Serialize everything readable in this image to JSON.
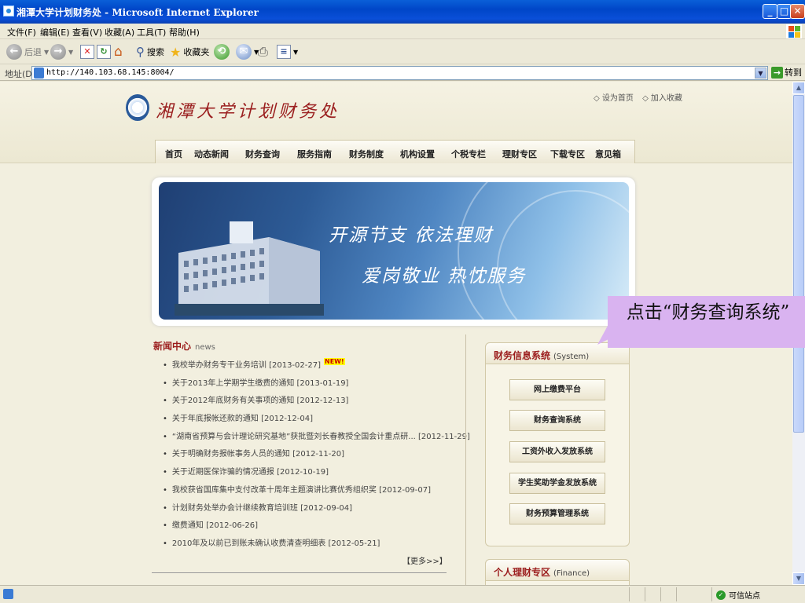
{
  "window": {
    "title": "湘潭大学计划财务处 - Microsoft Internet Explorer",
    "min_label": "_",
    "max_label": "□",
    "close_label": "✕"
  },
  "menu": [
    "文件(F)",
    "编辑(E)",
    "查看(V)",
    "收藏(A)",
    "工具(T)",
    "帮助(H)"
  ],
  "toolbar": {
    "back_label": "后退",
    "search_label": "搜索",
    "favorites_label": "收藏夹"
  },
  "address": {
    "label": "地址(D)",
    "url": "http://140.103.68.145:8004/",
    "go_label": "转到"
  },
  "site": {
    "title": "湘潭大学计划财务处",
    "toplinks": [
      "◇ 设为首页",
      "◇ 加入收藏"
    ],
    "nav": [
      "首页",
      "动态新闻",
      "财务查询",
      "服务指南",
      "财务制度",
      "机构设置",
      "个税专栏",
      "理财专区",
      "下载专区",
      "意见箱"
    ],
    "banner": {
      "slogan1": "开源节支  依法理财",
      "slogan2": "爱岗敬业  热忱服务"
    }
  },
  "news": {
    "title": "新闻中心",
    "subtitle": "news",
    "new_badge": "NEW!",
    "items": [
      "我校举办财务专干业务培训 [2013-02-27]",
      "关于2013年上学期学生缴费的通知 [2013-01-19]",
      "关于2012年底财务有关事项的通知 [2012-12-13]",
      "关于年底报帐还款的通知 [2012-12-04]",
      "“湖南省预算与会计理论研究基地”获批暨刘长春教授全国会计重点研... [2012-11-29]",
      "关于明确财务报帐事务人员的通知 [2012-11-20]",
      "关于近期医保诈骗的情况通报 [2012-10-19]",
      "我校获省国库集中支付改革十周年主题演讲比赛优秀组织奖 [2012-09-07]",
      "计划财务处举办会计继续教育培训班 [2012-09-04]",
      "缴费通知 [2012-06-26]",
      "2010年及以前已到账未确认收费清查明细表 [2012-05-21]"
    ],
    "more": "【更多>>】"
  },
  "system": {
    "title": "财务信息系统",
    "subtitle": "(System)",
    "buttons": [
      "网上缴费平台",
      "财务查询系统",
      "工资外收入发放系统",
      "学生奖助学金发放系统",
      "财务预算管理系统"
    ]
  },
  "finance": {
    "title": "个人理财专区",
    "subtitle": "(Finance)"
  },
  "callout": {
    "text": "点击“财务查询系统”"
  },
  "status": {
    "zone": "可信站点"
  }
}
